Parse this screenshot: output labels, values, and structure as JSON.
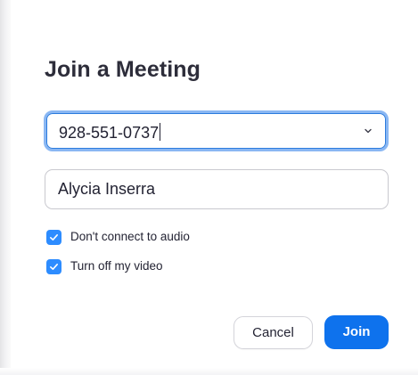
{
  "dialog": {
    "title": "Join a Meeting"
  },
  "meeting_id_field": {
    "value": "928-551-0737",
    "focused": true,
    "dropdown_icon": "chevron-down-icon"
  },
  "name_field": {
    "value": "Alycia Inserra"
  },
  "options": [
    {
      "label": "Don't connect to audio",
      "checked": true
    },
    {
      "label": "Turn off my video",
      "checked": true
    }
  ],
  "buttons": {
    "cancel_label": "Cancel",
    "join_label": "Join"
  },
  "colors": {
    "accent": "#0e72ed",
    "checkbox": "#2d8cff",
    "focus_ring": "#8ab7f3",
    "text": "#232333",
    "title": "#2d2d3a"
  }
}
